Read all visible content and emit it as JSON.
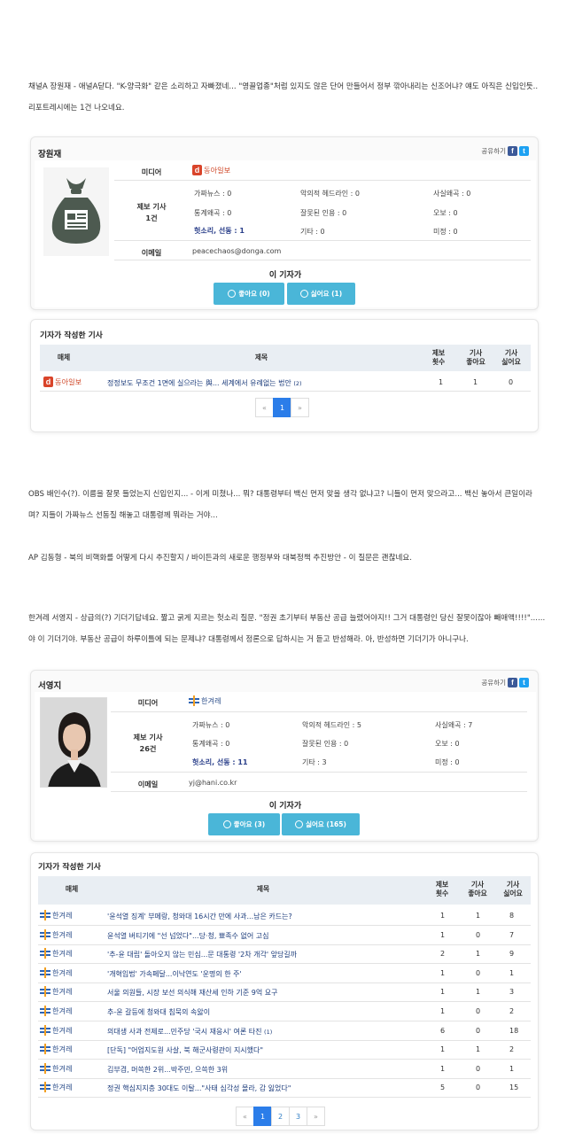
{
  "para1": "채널A 장원재 - 애널A닫다. \"K-양극화\" 같은 소리하고 자빠졌네... \"영끌업종\"처럼 있지도 않은 단어 만들어서 정부 깎아내리는 신조어냐? 얘도 아직은 신입인듯.. 리포트레시에는 1건 나오네요.",
  "para2": "OBS 배인수(?). 이름을 잘못 들었는지 신입인지... - 이게 미쳤나... 뭐? 대통령부터 백신 먼저 맞을 생각 없냐고? 니들이 먼저 맞으라고... 백신 놓아서 큰일이라며? 지들이 가짜뉴스 선동질 해놓고 대통령께 뭐라는 거야...",
  "para3": "AP 김동형 - 북의 비핵화를 어떻게 다시 추진할지 / 바이든과의 새로운 행정부와 대북정책 추진방안 - 이 질문은 괜찮네요.",
  "para4": "한겨레 서영지 - 상급의(?) 기더기답네요. 짧고 굵게 지르는 헛소리 질문. \"정권 초기부터 부동산 공급 늘렸어야지!! 그거 대통령인 당신 잘못이잖아 빼애액!!!!\"...... 야 이 기더기야. 부동산 공급이 하루이틀에 되는 문제냐? 대통령께서 정론으로 답하시는 거 듣고 반성해라. 아, 반성하면 기더기가 아니구나.",
  "share_label": "공유하기",
  "labels": {
    "media": "미디어",
    "report": "제보 기사",
    "email": "이메일",
    "this_reporter": "이 기자가",
    "articles_title": "기자가 작성한 기사"
  },
  "th": {
    "media": "매체",
    "title": "제목",
    "reports": "제보\n횟수",
    "likes": "기사\n좋아요",
    "dislikes": "기사\n싫어요"
  },
  "reporter1": {
    "name": "장원재",
    "media": "동아일보",
    "report_count": "1건",
    "email": "peacechaos@donga.com",
    "stats": [
      "가짜뉴스 : 0",
      "악의적 헤드라인 : 0",
      "사실왜곡 : 0",
      "통계왜곡 : 0",
      "잘못된 인용 : 0",
      "오보 : 0",
      "헛소리, 선동 : 1",
      "기타 : 0",
      "미정 : 0"
    ],
    "like_btn": "좋아요 (0)",
    "dislike_btn": "싫어요 (1)",
    "articles": [
      {
        "media": "동아일보",
        "title": "정정보도 무조건 1면에 실으라는 與... 세계에서 유례없는 법안",
        "count": "(2)",
        "r": "1",
        "l": "1",
        "d": "0"
      }
    ],
    "pages": [
      "«",
      "1",
      "»"
    ]
  },
  "reporter2": {
    "name": "서영지",
    "media": "한겨레",
    "report_count": "26건",
    "email": "yj@hani.co.kr",
    "stats": [
      "가짜뉴스 : 0",
      "악의적 헤드라인 : 5",
      "사실왜곡 : 7",
      "통계왜곡 : 0",
      "잘못된 인용 : 0",
      "오보 : 0",
      "헛소리, 선동 : 11",
      "기타 : 3",
      "미정 : 0"
    ],
    "like_btn": "좋아요 (3)",
    "dislike_btn": "싫어요 (165)",
    "articles": [
      {
        "media": "한겨레",
        "title": "'윤석열 징계' 부메랑, 청와대 16시간 만에 사과...남은 카드는?",
        "count": "",
        "r": "1",
        "l": "1",
        "d": "8"
      },
      {
        "media": "한겨레",
        "title": "윤석열 버티기에 \"선 넘었다\"...당·청, 뾰족수 없어 고심",
        "count": "",
        "r": "1",
        "l": "0",
        "d": "7"
      },
      {
        "media": "한겨레",
        "title": "'추-윤 대립' 돌아오지 않는 민심...문 대통령 '2차 개각' 앞당길까",
        "count": "",
        "r": "2",
        "l": "1",
        "d": "9"
      },
      {
        "media": "한겨레",
        "title": "'개혁입법' 가속페달...이낙연도 '운명의 한 주'",
        "count": "",
        "r": "1",
        "l": "0",
        "d": "1"
      },
      {
        "media": "한겨레",
        "title": "서울 의원들, 시장 보선 의식해 재산세 인하 기준 9억 요구",
        "count": "",
        "r": "1",
        "l": "1",
        "d": "3"
      },
      {
        "media": "한겨레",
        "title": "추-윤 갈등에 청와대 침묵의 속앓이",
        "count": "",
        "r": "1",
        "l": "0",
        "d": "2"
      },
      {
        "media": "한겨레",
        "title": "의대생 사과 전제로...민주당 '국시 재응시' 여론 타진",
        "count": "(1)",
        "r": "6",
        "l": "0",
        "d": "18"
      },
      {
        "media": "한겨레",
        "title": "[단독] \"어업지도원 사살, 북 해군사령관이 지시했다\"",
        "count": "",
        "r": "1",
        "l": "1",
        "d": "2"
      },
      {
        "media": "한겨레",
        "title": "김부겸, 머쓱한 2위...박주민, 으쓱한 3위",
        "count": "",
        "r": "1",
        "l": "0",
        "d": "1"
      },
      {
        "media": "한겨레",
        "title": "정권 핵심지지층 30대도 이탈...\"사태 심각성 몰라, 감 잃었다\"",
        "count": "",
        "r": "5",
        "l": "0",
        "d": "15"
      }
    ],
    "pages": [
      "«",
      "1",
      "2",
      "3",
      "»"
    ]
  },
  "colors": {
    "button": "#4ab6d8",
    "page_active": "#2b7de9",
    "donga": "#d9442a",
    "link": "#2a3f8a"
  }
}
